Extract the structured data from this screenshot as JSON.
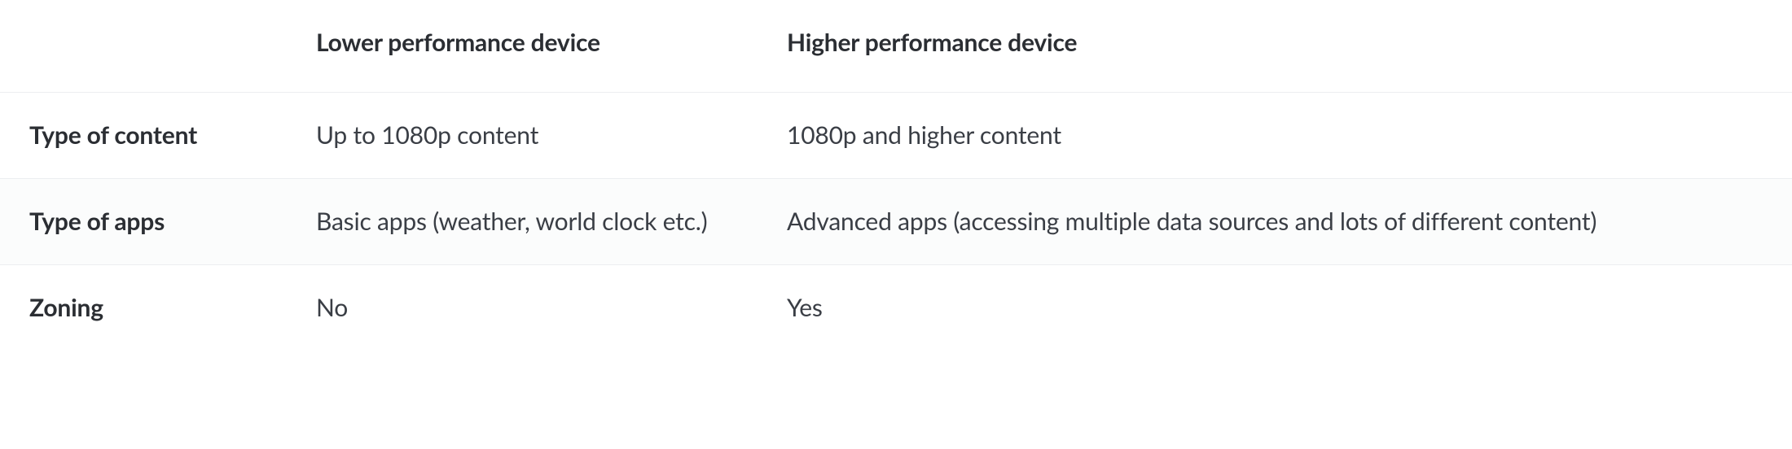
{
  "headers": {
    "corner": "",
    "lower": "Lower performance device",
    "higher": "Higher performance device"
  },
  "rows": [
    {
      "label": "Type of content",
      "lower": "Up to 1080p content",
      "higher": "1080p and higher content"
    },
    {
      "label": "Type of apps",
      "lower": "Basic apps (weather, world clock etc.)",
      "higher": "Advanced apps (accessing multiple data sources and lots of different content)"
    },
    {
      "label": "Zoning",
      "lower": "No",
      "higher": "Yes"
    }
  ]
}
